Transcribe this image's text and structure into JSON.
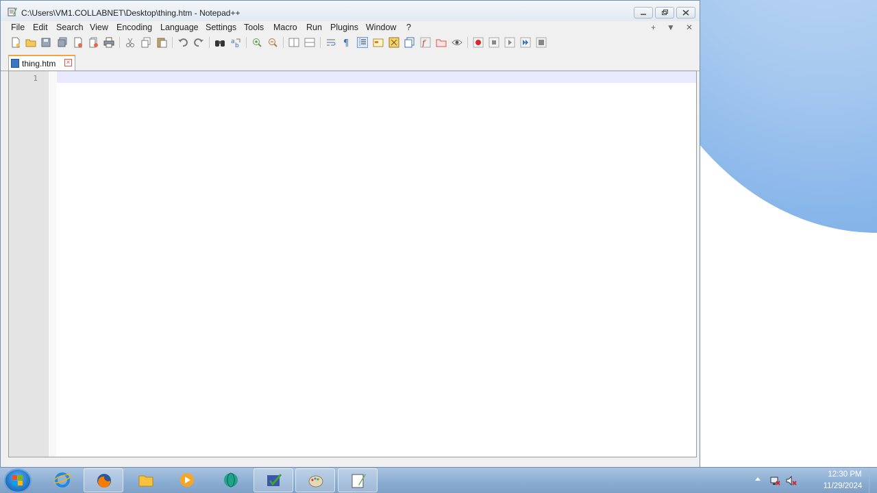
{
  "window": {
    "title": "C:\\Users\\VM1.COLLABNET\\Desktop\\thing.htm - Notepad++",
    "minimize_icon": "minimize-icon",
    "maximize_icon": "restore-icon",
    "close_icon": "close-icon"
  },
  "menu": {
    "items": [
      "File",
      "Edit",
      "Search",
      "View",
      "Encoding",
      "Language",
      "Settings",
      "Tools",
      "Macro",
      "Run",
      "Plugins",
      "Window",
      "?"
    ],
    "right": [
      "+",
      "▼",
      "✕"
    ]
  },
  "tab": {
    "label": "thing.htm"
  },
  "editor": {
    "line_number": "1"
  },
  "taskbar": {
    "time": "12:30 PM",
    "date": "11/29/2024"
  },
  "colors": {
    "current_line": "#e8e8ff",
    "tab_accent": "#f9a13a",
    "taskbar": "#8fb0d5"
  }
}
